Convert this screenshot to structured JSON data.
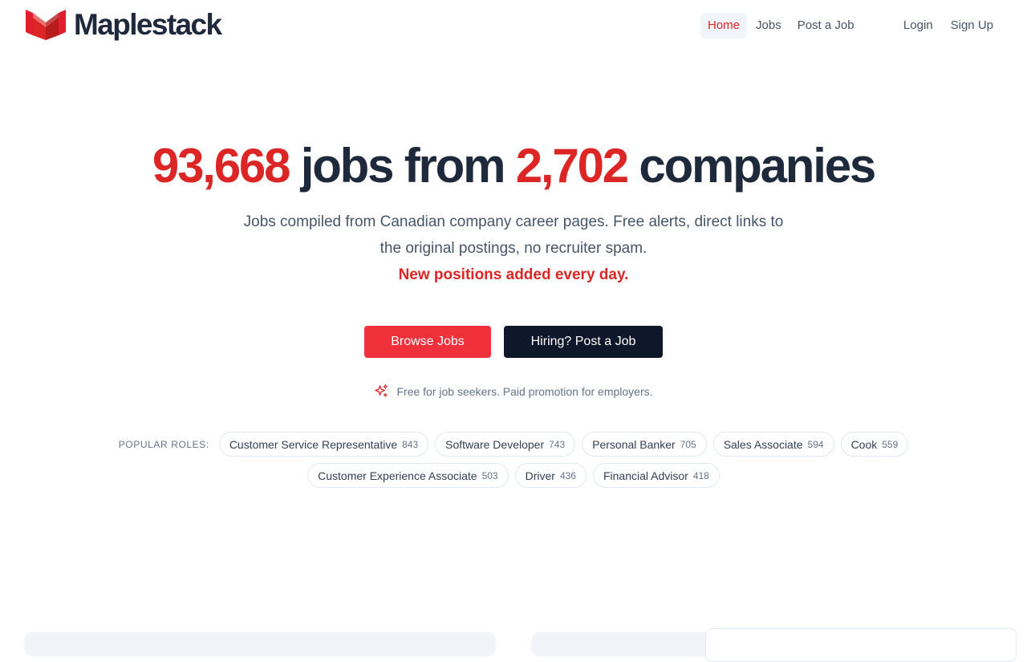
{
  "brand": {
    "name": "Maplestack",
    "logo_icon": "maple-chevron-logo",
    "accent": "#dc2626"
  },
  "nav": {
    "items": [
      {
        "label": "Home",
        "active": true
      },
      {
        "label": "Jobs",
        "active": false
      },
      {
        "label": "Post a Job",
        "active": false
      }
    ],
    "auth": [
      {
        "label": "Login"
      },
      {
        "label": "Sign Up"
      }
    ]
  },
  "hero": {
    "jobs_count": "93,668",
    "title_mid": "jobs from",
    "companies_count": "2,702",
    "title_end": "companies",
    "subtitle": "Jobs compiled from Canadian company career pages. Free alerts, direct links to the original postings, no recruiter spam.",
    "subtitle_strong": "New positions added every day.",
    "primary_cta": "Browse Jobs",
    "secondary_cta": "Hiring? Post a Job",
    "note": "Free for job seekers. Paid promotion for employers.",
    "note_icon": "sparkles-icon"
  },
  "popular": {
    "label": "POPULAR ROLES:",
    "roles": [
      {
        "name": "Customer Service Representative",
        "count": "843"
      },
      {
        "name": "Software Developer",
        "count": "743"
      },
      {
        "name": "Personal Banker",
        "count": "705"
      },
      {
        "name": "Sales Associate",
        "count": "594"
      },
      {
        "name": "Cook",
        "count": "559"
      },
      {
        "name": "Customer Experience Associate",
        "count": "503"
      },
      {
        "name": "Driver",
        "count": "436"
      },
      {
        "name": "Financial Advisor",
        "count": "418"
      }
    ]
  },
  "colors": {
    "primary_button": "#f0303a",
    "dark_button": "#0f172a",
    "text": "#1e293b"
  }
}
